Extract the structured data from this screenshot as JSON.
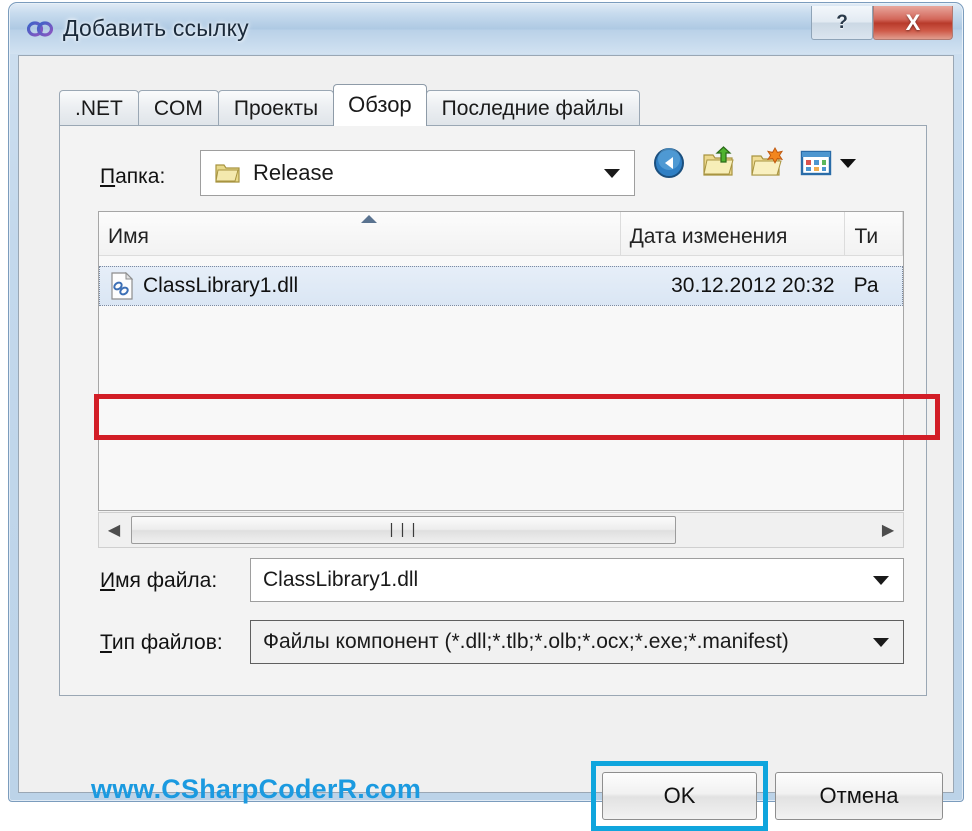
{
  "window": {
    "title": "Добавить ссылку",
    "icon": "link-infinity-icon",
    "help_label": "?",
    "close_label": "X"
  },
  "tabs": [
    {
      "label": ".NET",
      "active": false
    },
    {
      "label": "COM",
      "active": false
    },
    {
      "label": "Проекты",
      "active": false
    },
    {
      "label": "Обзор",
      "active": true
    },
    {
      "label": "Последние файлы",
      "active": false
    }
  ],
  "browse": {
    "folder_label": "Папка:",
    "folder_label_accel": "П",
    "folder_label_rest": "апка:",
    "folder_value": "Release",
    "folder_icon": "folder-icon",
    "toolbar": [
      {
        "name": "back-icon",
        "tooltip": "Назад"
      },
      {
        "name": "up-folder-icon",
        "tooltip": "Вверх"
      },
      {
        "name": "new-folder-icon",
        "tooltip": "Создать папку"
      },
      {
        "name": "views-icon",
        "tooltip": "Виды"
      }
    ],
    "columns": [
      {
        "key": "name",
        "label": "Имя",
        "sorted": "asc"
      },
      {
        "key": "date",
        "label": "Дата изменения",
        "sorted": ""
      },
      {
        "key": "type",
        "label": "Ти",
        "sorted": ""
      }
    ],
    "rows": [
      {
        "icon": "dll-file-icon",
        "name": "ClassLibrary1.dll",
        "date": "30.12.2012 20:32",
        "type": "Ра",
        "selected": true
      }
    ],
    "scrollbar": {
      "left_arrow": "◀",
      "right_arrow": "▶",
      "grip": "|||"
    },
    "filename_label": "Имя файла:",
    "filename_label_accel": "И",
    "filename_label_rest": "мя файла:",
    "filename_value": "ClassLibrary1.dll",
    "filename_placeholder": "Имя файла",
    "filetype_label": "Тип файлов:",
    "filetype_label_accel": "Т",
    "filetype_label_rest": "ип файлов:",
    "filetype_value": "Файлы компонент (*.dll;*.tlb;*.olb;*.ocx;*.exe;*.manifest)"
  },
  "footer": {
    "watermark": "www.CSharpCoderR.com",
    "ok_label": "OK",
    "cancel_label": "Отмена"
  },
  "annotations": {
    "row_highlight_color": "#d21d26",
    "ok_highlight_color": "#0fa5dd"
  }
}
